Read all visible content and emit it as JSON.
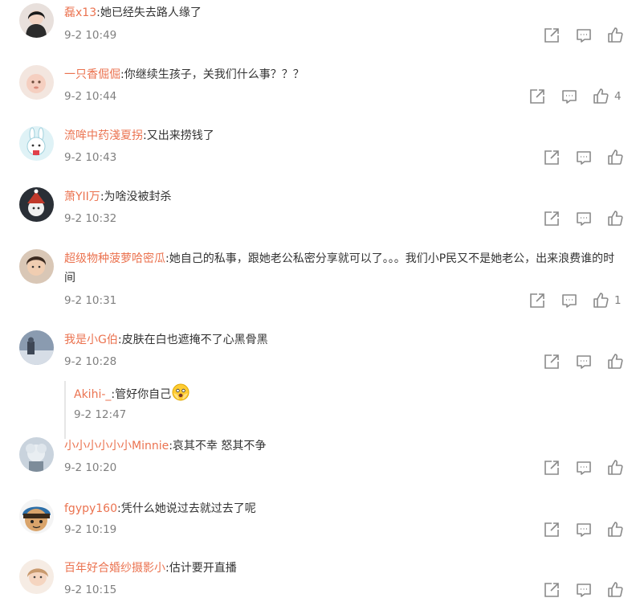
{
  "comments": [
    {
      "user": "磊x13",
      "text": ":她已经失去路人缘了",
      "time": "9-2 10:49",
      "likes": ""
    },
    {
      "user": "一只香倔倔",
      "text": ":你继续生孩子，关我们什么事？？？",
      "time": "9-2 10:44",
      "likes": "4"
    },
    {
      "user": "流哞中药淺夏拐",
      "text": ":又出来捞钱了",
      "time": "9-2 10:43",
      "likes": ""
    },
    {
      "user": "萧YII万",
      "text": ":为啥没被封杀",
      "time": "9-2 10:32",
      "likes": ""
    },
    {
      "user": "超级物种菠萝哈密瓜",
      "text": ":她自己的私事，跟她老公私密分享就可以了。。。我们小P民又不是她老公，出来浪费谁的时间",
      "time": "9-2 10:31",
      "likes": "1"
    },
    {
      "user": "我是小G伯",
      "text": ":皮肤在白也遮掩不了心黑骨黑",
      "time": "9-2 10:28",
      "likes": "",
      "reply": {
        "user": "Akihi-_",
        "text": ":管好你自己",
        "time": "9-2 12:47"
      }
    },
    {
      "user": "小小小小小小Minnie",
      "text": ":哀其不幸 怒其不争",
      "time": "9-2 10:20",
      "likes": ""
    },
    {
      "user": "fgypy160",
      "text": ":凭什么她说过去就过去了呢",
      "time": "9-2 10:19",
      "likes": ""
    },
    {
      "user": "百年好合婚纱摄影小",
      "text": ":估计要开直播",
      "time": "9-2 10:15",
      "likes": ""
    }
  ],
  "icons": {
    "share": "share-icon",
    "comment": "comment-icon",
    "like": "thumbs-up-icon"
  },
  "colors": {
    "username": "#eb7350",
    "meta": "#808080",
    "text": "#333333"
  }
}
